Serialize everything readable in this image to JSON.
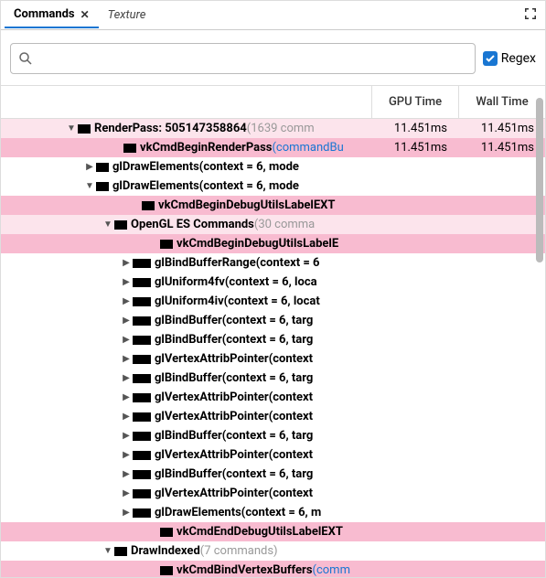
{
  "tabs": {
    "active": "Commands",
    "inactive": "Texture"
  },
  "search": {
    "value": "",
    "placeholder": ""
  },
  "regex_label": "Regex",
  "columns": {
    "gpu": "GPU Time",
    "wall": "Wall Time"
  },
  "rows": [
    {
      "indent": 70,
      "arrow": "down",
      "bold": true,
      "pink": "light",
      "label": "RenderPass: 505147358864",
      "suffix": " (1639 comm",
      "gpu": "11.451ms",
      "wall": "11.451ms"
    },
    {
      "indent": 120,
      "arrow": "",
      "bold": true,
      "pink": "med",
      "label": "vkCmdBeginRenderPass",
      "link": "(commandBu",
      "gpu": "11.451ms",
      "wall": "11.451ms"
    },
    {
      "indent": 90,
      "arrow": "right",
      "bold": true,
      "pink": "",
      "label": "glDrawElements(context = 6, mode"
    },
    {
      "indent": 90,
      "arrow": "down",
      "bold": true,
      "pink": "",
      "label": "glDrawElements(context = 6, mode"
    },
    {
      "indent": 140,
      "arrow": "",
      "bold": true,
      "pink": "med",
      "label": "vkCmdBeginDebugUtilsLabelEXT"
    },
    {
      "indent": 110,
      "arrow": "down",
      "bold": true,
      "pink": "light",
      "label": "OpenGL ES Commands",
      "suffix": " (30 comma"
    },
    {
      "indent": 160,
      "arrow": "",
      "bold": true,
      "pink": "med",
      "label": "vkCmdBeginDebugUtilsLabelE"
    },
    {
      "indent": 130,
      "arrow": "right",
      "bold": true,
      "pink": "",
      "wide": true,
      "label": "glBindBufferRange(context = 6"
    },
    {
      "indent": 130,
      "arrow": "right",
      "bold": true,
      "pink": "",
      "wide": true,
      "label": "glUniform4fv(context = 6, loca"
    },
    {
      "indent": 130,
      "arrow": "right",
      "bold": true,
      "pink": "",
      "wide": true,
      "label": "glUniform4iv(context = 6, locat"
    },
    {
      "indent": 130,
      "arrow": "right",
      "bold": true,
      "pink": "",
      "wide": true,
      "label": "glBindBuffer(context = 6, targ"
    },
    {
      "indent": 130,
      "arrow": "right",
      "bold": true,
      "pink": "",
      "wide": true,
      "label": "glBindBuffer(context = 6, targ"
    },
    {
      "indent": 130,
      "arrow": "right",
      "bold": true,
      "pink": "",
      "wide": true,
      "label": "glVertexAttribPointer(context"
    },
    {
      "indent": 130,
      "arrow": "right",
      "bold": true,
      "pink": "",
      "wide": true,
      "label": "glBindBuffer(context = 6, targ"
    },
    {
      "indent": 130,
      "arrow": "right",
      "bold": true,
      "pink": "",
      "wide": true,
      "label": "glVertexAttribPointer(context"
    },
    {
      "indent": 130,
      "arrow": "right",
      "bold": true,
      "pink": "",
      "wide": true,
      "label": "glVertexAttribPointer(context"
    },
    {
      "indent": 130,
      "arrow": "right",
      "bold": true,
      "pink": "",
      "wide": true,
      "label": "glBindBuffer(context = 6, targ"
    },
    {
      "indent": 130,
      "arrow": "right",
      "bold": true,
      "pink": "",
      "wide": true,
      "label": "glVertexAttribPointer(context"
    },
    {
      "indent": 130,
      "arrow": "right",
      "bold": true,
      "pink": "",
      "wide": true,
      "label": "glBindBuffer(context = 6, targ"
    },
    {
      "indent": 130,
      "arrow": "right",
      "bold": true,
      "pink": "",
      "wide": true,
      "label": "glVertexAttribPointer(context"
    },
    {
      "indent": 130,
      "arrow": "right",
      "bold": true,
      "pink": "",
      "wide": true,
      "label": "glDrawElements(context = 6, m"
    },
    {
      "indent": 160,
      "arrow": "",
      "bold": true,
      "pink": "med",
      "label": "vkCmdEndDebugUtilsLabelEXT"
    },
    {
      "indent": 110,
      "arrow": "down",
      "bold": true,
      "pink": "",
      "label": "DrawIndexed",
      "suffix": " (7 commands)"
    },
    {
      "indent": 160,
      "arrow": "",
      "bold": true,
      "pink": "med",
      "label": "vkCmdBindVertexBuffers",
      "link": "(comm"
    }
  ]
}
